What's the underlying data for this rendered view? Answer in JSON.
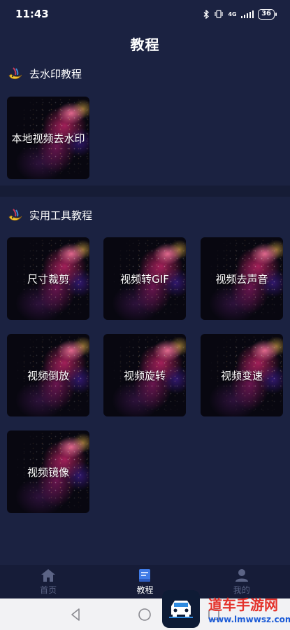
{
  "status_bar": {
    "time": "11:43",
    "network": "4G",
    "battery": "36"
  },
  "header": {
    "title": "教程"
  },
  "sections": [
    {
      "title": "去水印教程",
      "icon": "banana-icon",
      "items": [
        {
          "label": "本地视频去水印"
        }
      ]
    },
    {
      "title": "实用工具教程",
      "icon": "banana-icon",
      "items": [
        {
          "label": "尺寸裁剪"
        },
        {
          "label": "视频转GIF"
        },
        {
          "label": "视频去声音"
        },
        {
          "label": "视频倒放"
        },
        {
          "label": "视频旋转"
        },
        {
          "label": "视频变速"
        },
        {
          "label": "视频镜像"
        }
      ]
    }
  ],
  "bottom_nav": {
    "items": [
      {
        "label": "首页",
        "icon": "home-icon",
        "active": false
      },
      {
        "label": "教程",
        "icon": "book-icon",
        "active": true
      },
      {
        "label": "我的",
        "icon": "user-icon",
        "active": false
      }
    ]
  },
  "system_nav": {
    "buttons": [
      "back-icon",
      "home-circle-icon",
      "recents-icon"
    ]
  },
  "watermark": {
    "text": "道车手游网",
    "url": "www.lmwwsz.com"
  },
  "colors": {
    "background": "#1b2241",
    "band": "#161c36",
    "nav_inactive": "#5b6385",
    "nav_active": "#ffffff"
  }
}
